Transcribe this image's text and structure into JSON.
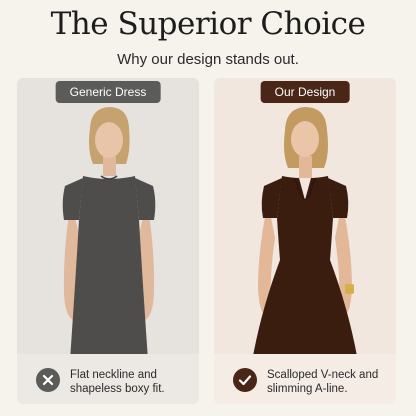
{
  "header": {
    "title": "The Superior Choice",
    "subtitle": "Why our design stands out."
  },
  "comparison": {
    "generic": {
      "label": "Generic Dress",
      "caption_line1": "Flat neckline and",
      "caption_line2": "shapeless boxy fit.",
      "icon": "x-icon",
      "dress_color": "#4e4d4b"
    },
    "ours": {
      "label": "Our Design",
      "caption_line1": "Scalloped V-neck and",
      "caption_line2": "slimming A-line.",
      "icon": "check-icon",
      "dress_color": "#3b1d10"
    }
  }
}
